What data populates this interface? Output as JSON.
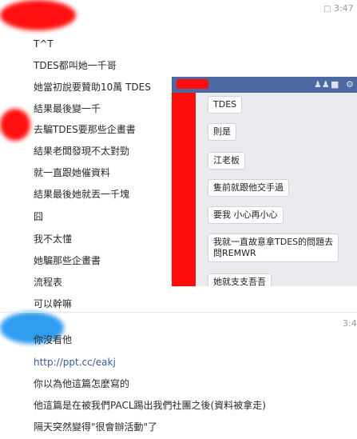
{
  "conversation": {
    "first_block": {
      "timestamp": "3:47",
      "messages": [
        "T^T",
        "TDES都叫她一千哥",
        "她當初說要贊助10萬 TDES",
        "結果最後變一千",
        "去騙TDES要那些企畫書",
        "結果老闆發現不太對勁",
        "就一直跟她催資料",
        "結果最後她就丟一千塊",
        "囧",
        "我不太懂",
        "她騙那些企畫書",
        "流程表",
        "可以幹嘛"
      ]
    },
    "second_block": {
      "timestamp": "3:4",
      "messages": [
        "你沒看他",
        "http://ppt.cc/eakj",
        "你以為他這篇怎麼寫的",
        "他這篇是在被我們PACL踢出我們社團之後(資料被拿走)",
        "隔天突然變得\"很會辦活動\"了"
      ]
    }
  },
  "embedded_chat": {
    "messages": [
      "TDES",
      "則是",
      "江老板",
      "隻前就跟他交手過",
      "要我 小心再小心",
      "我就一直故意拿TDES的問題去",
      "問REMWR",
      "她就支支吾吾"
    ],
    "header_icons": [
      "people-icon",
      "video-icon",
      "gear-icon"
    ]
  },
  "colors": {
    "redaction_red": "#ff1010",
    "redaction_blue": "#2f9df0",
    "embed_header": "#4e69a2",
    "link": "#3b5998"
  }
}
